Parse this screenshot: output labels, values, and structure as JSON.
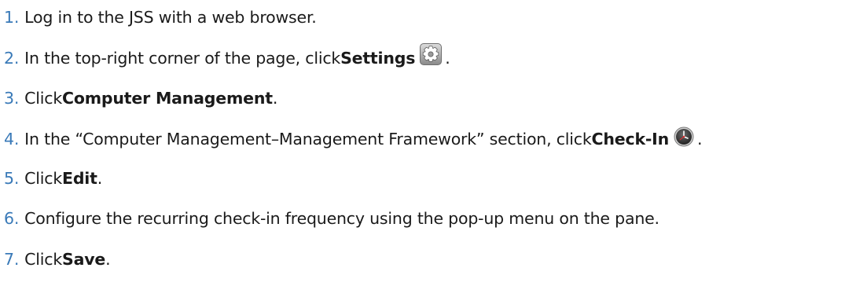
{
  "steps": [
    {
      "number": "1.",
      "parts": [
        "Log in to the JSS with a web browser."
      ]
    },
    {
      "number": "2.",
      "parts": [
        "In the top-right corner of the page, click ",
        "Settings",
        "."
      ],
      "icon": "gear-icon"
    },
    {
      "number": "3.",
      "parts": [
        "Click ",
        "Computer Management",
        "."
      ]
    },
    {
      "number": "4.",
      "parts": [
        "In the “Computer Management–Management Framework” section, click ",
        "Check-In",
        "."
      ],
      "icon": "clock-icon"
    },
    {
      "number": "5.",
      "parts": [
        "Click ",
        "Edit",
        "."
      ]
    },
    {
      "number": "6.",
      "parts": [
        "Configure the recurring check-in frequency using the pop-up menu on the pane."
      ]
    },
    {
      "number": "7.",
      "parts": [
        "Click ",
        "Save",
        "."
      ]
    }
  ],
  "colors": {
    "step_number": "#3a7ab8",
    "text": "#1a1a1a"
  }
}
